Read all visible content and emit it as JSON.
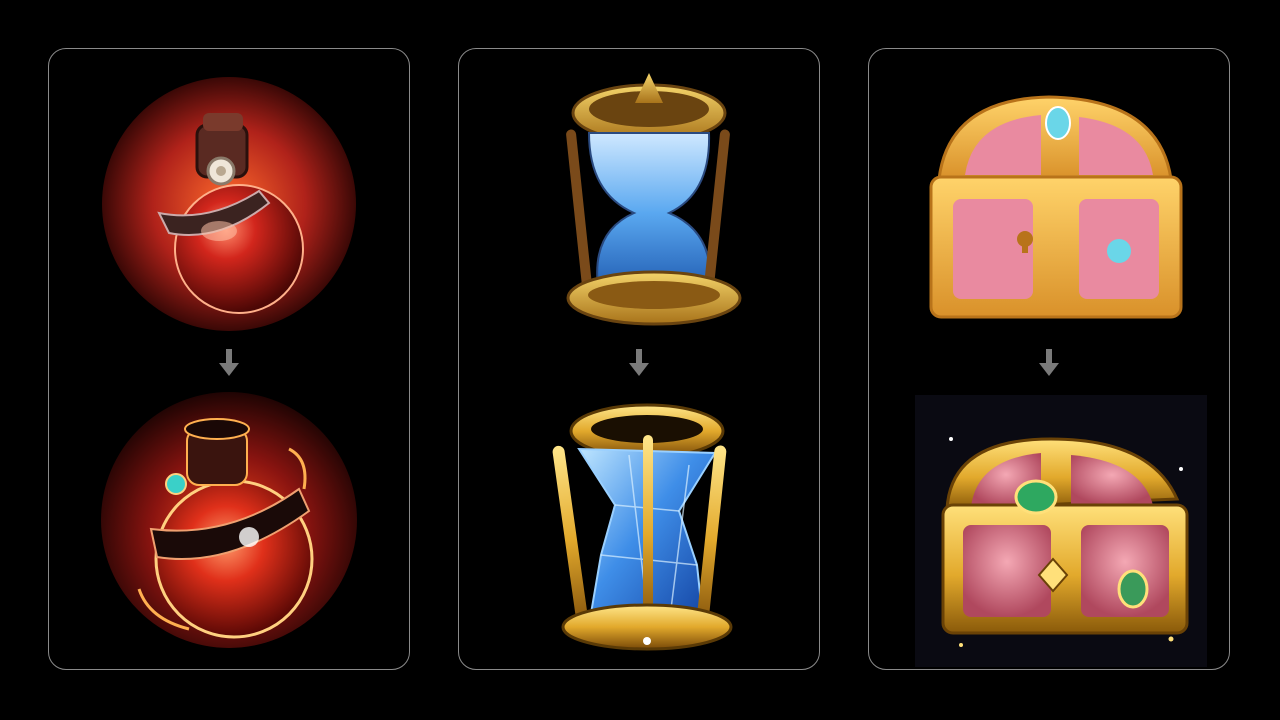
{
  "panels": [
    {
      "id": "potion",
      "before": "red-potion-flask-icon",
      "after": "red-potion-flask-icon-enhanced"
    },
    {
      "id": "hourglass",
      "before": "blue-hourglass-icon",
      "after": "crystal-hourglass-icon-enhanced"
    },
    {
      "id": "chest",
      "before": "pink-treasure-chest-icon",
      "after": "gold-treasure-chest-icon-enhanced"
    }
  ],
  "colors": {
    "background": "#000000",
    "card_border": "#8a8a8a",
    "arrow": "#7a7a7a",
    "potion_red": "#c0241a",
    "hourglass_blue": "#5aa8f0",
    "gold": "#e2a92c",
    "chest_pink": "#e98aa0"
  }
}
